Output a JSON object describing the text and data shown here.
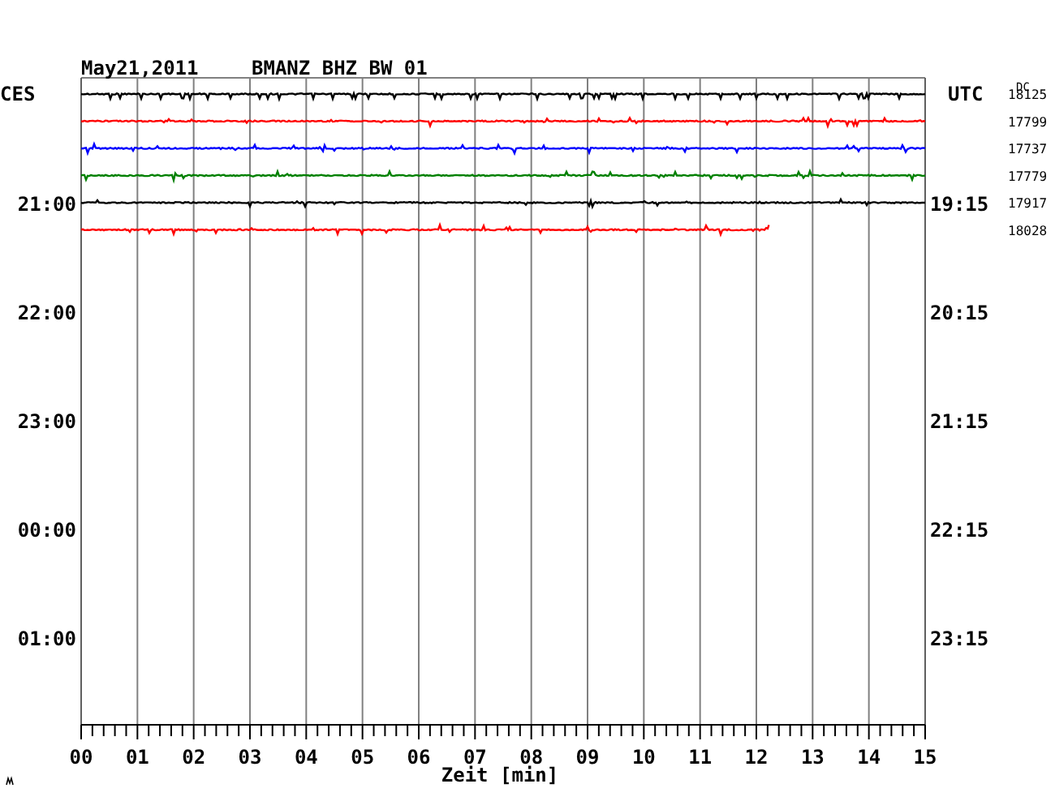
{
  "header": {
    "date": "May21,2011",
    "station": "BMANZ BHZ BW 01"
  },
  "left_axis": {
    "title": "CES",
    "labels": [
      "21:00",
      "22:00",
      "23:00",
      "00:00",
      "01:00"
    ]
  },
  "right_axis": {
    "title": "UTC",
    "labels": [
      "19:15",
      "20:15",
      "21:15",
      "22:15",
      "23:15"
    ]
  },
  "dc_title": "DC",
  "traces": [
    {
      "color": "#000000",
      "dc": "18125",
      "level": 1
    },
    {
      "color": "#ff0000",
      "dc": "17799",
      "level": 1
    },
    {
      "color": "#0000ff",
      "dc": "17737",
      "level": 1
    },
    {
      "color": "#008000",
      "dc": "17779",
      "level": 1
    },
    {
      "color": "#000000",
      "dc": "17917",
      "level": 1
    },
    {
      "color": "#ff0000",
      "dc": "18028",
      "level": 0.816
    }
  ],
  "x_axis": {
    "ticks": [
      "00",
      "01",
      "02",
      "03",
      "04",
      "05",
      "06",
      "07",
      "08",
      "09",
      "10",
      "11",
      "12",
      "13",
      "14",
      "15"
    ],
    "label": "Zeit [min]"
  }
}
